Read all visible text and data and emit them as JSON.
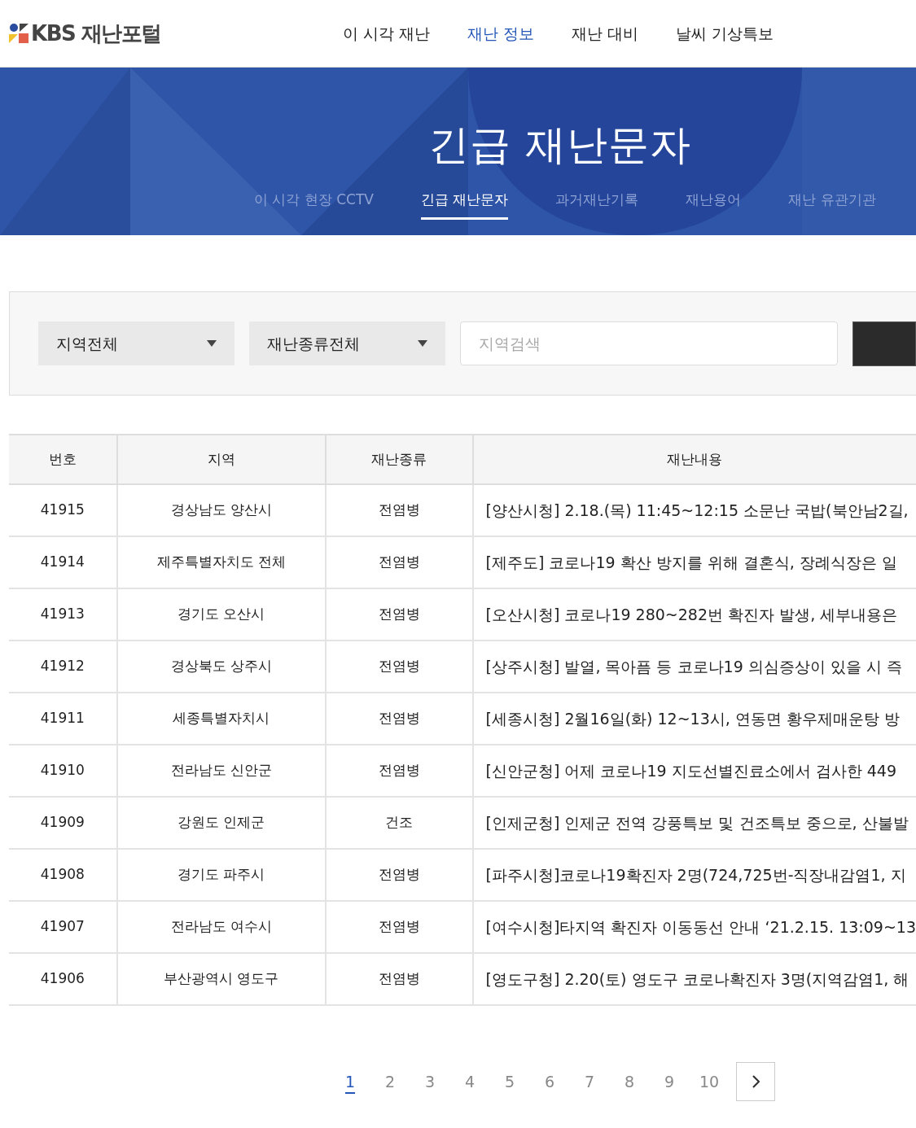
{
  "header": {
    "logo": "KBS 재난포털",
    "nav": [
      {
        "label": "이 시각 재난",
        "selected": false
      },
      {
        "label": "재난 정보",
        "selected": true
      },
      {
        "label": "재난 대비",
        "selected": false
      },
      {
        "label": "날씨 기상특보",
        "selected": false
      }
    ]
  },
  "banner": {
    "title": "긴급 재난문자",
    "tabs": [
      {
        "label": "이 시각 현장 CCTV",
        "selected": false
      },
      {
        "label": "긴급 재난문자",
        "selected": true
      },
      {
        "label": "과거재난기록",
        "selected": false
      },
      {
        "label": "재난용어",
        "selected": false
      },
      {
        "label": "재난 유관기관",
        "selected": false
      }
    ]
  },
  "filters": {
    "region": "지역전체",
    "type": "재난종류전체",
    "search": {
      "placeholder": "지역검색"
    }
  },
  "table": {
    "columns": [
      "번호",
      "지역",
      "재난종류",
      "재난내용"
    ],
    "rows": [
      [
        "41915",
        "경상남도 양산시",
        "전염병",
        "[양산시청] 2.18.(목) 11:45~12:15 소문난 국밥(북안남2길,"
      ],
      [
        "41914",
        "제주특별자치도 전체",
        "전염병",
        "[제주도] 코로나19 확산 방지를 위해 결혼식, 장례식장은 일"
      ],
      [
        "41913",
        "경기도 오산시",
        "전염병",
        "[오산시청] 코로나19 280~282번 확진자 발생, 세부내용은"
      ],
      [
        "41912",
        "경상북도 상주시",
        "전염병",
        "[상주시청] 발열, 목아픔 등 코로나19 의심증상이 있을 시 즉"
      ],
      [
        "41911",
        "세종특별자치시",
        "전염병",
        "[세종시청] 2월16일(화) 12~13시, 연동면 황우제매운탕 방"
      ],
      [
        "41910",
        "전라남도 신안군",
        "전염병",
        "[신안군청] 어제 코로나19 지도선별진료소에서 검사한 449"
      ],
      [
        "41909",
        "강원도 인제군",
        "건조",
        "[인제군청] 인제군 전역 강풍특보 및 건조특보 중으로, 산불발"
      ],
      [
        "41908",
        "경기도 파주시",
        "전염병",
        "[파주시청]코로나19확진자 2명(724,725번-직장내감염1, 지"
      ],
      [
        "41907",
        "전라남도 여수시",
        "전염병",
        "[여수시청]타지역 확진자 이동동선 안내 ‘21.2.15. 13:09~13"
      ],
      [
        "41906",
        "부산광역시 영도구",
        "전염병",
        "[영도구청] 2.20(토) 영도구 코로나확진자 3명(지역감염1, 해"
      ]
    ]
  },
  "pagination": {
    "pages": [
      {
        "label": "1",
        "selected": true
      },
      {
        "label": "2",
        "selected": false
      },
      {
        "label": "3",
        "selected": false
      },
      {
        "label": "4",
        "selected": false
      },
      {
        "label": "5",
        "selected": false
      },
      {
        "label": "6",
        "selected": false
      },
      {
        "label": "7",
        "selected": false
      },
      {
        "label": "8",
        "selected": false
      },
      {
        "label": "9",
        "selected": false
      },
      {
        "label": "10",
        "selected": false
      }
    ]
  }
}
